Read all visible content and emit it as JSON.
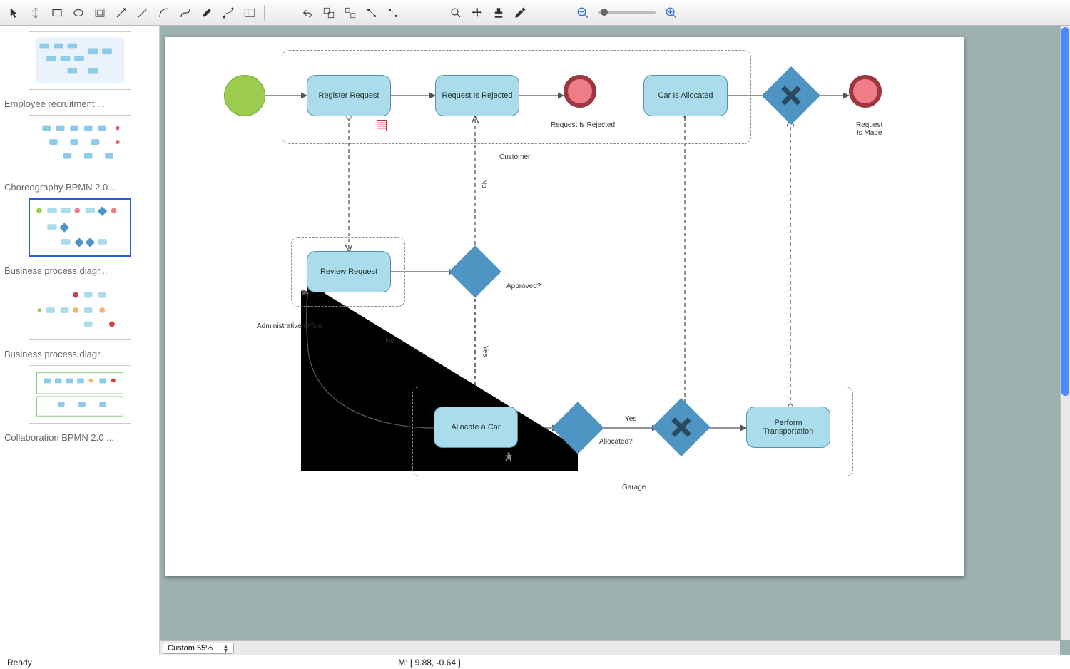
{
  "toolbar": {
    "items": [
      {
        "name": "pointer-icon"
      },
      {
        "name": "text-cursor-icon"
      },
      {
        "name": "rect-icon"
      },
      {
        "name": "ellipse-icon"
      },
      {
        "name": "container-icon"
      },
      {
        "name": "arrow-icon"
      },
      {
        "name": "line-icon"
      },
      {
        "name": "curve-icon"
      },
      {
        "name": "bezier-icon"
      },
      {
        "name": "pen-icon"
      },
      {
        "name": "node-edit-icon"
      },
      {
        "name": "pane-icon"
      }
    ],
    "edit_items": [
      {
        "name": "undo-icon"
      },
      {
        "name": "group-icon"
      },
      {
        "name": "ungroup-icon"
      },
      {
        "name": "connect-icon"
      },
      {
        "name": "disconnect-icon"
      }
    ],
    "view_items": [
      {
        "name": "zoom-icon"
      },
      {
        "name": "pan-icon"
      },
      {
        "name": "stamp-icon"
      },
      {
        "name": "eyedropper-icon"
      }
    ],
    "zoom": {
      "out": "zoom-out-icon",
      "in": "zoom-in-icon"
    }
  },
  "sidebar": {
    "items": [
      {
        "label": "Employee recruitment ..."
      },
      {
        "label": "Choreography BPMN 2.0..."
      },
      {
        "label": "Business process diagr...",
        "selected": true
      },
      {
        "label": "Business process diagr..."
      },
      {
        "label": "Collaboration BPMN 2.0 ..."
      }
    ]
  },
  "zoomSelect": "Custom 55%",
  "status": {
    "ready": "Ready",
    "coords": "M: [ 9.88, -0.64 ]"
  },
  "diagram": {
    "pools": {
      "customer": "Customer",
      "admin": "Administrative Office",
      "garage": "Garage"
    },
    "tasks": {
      "register": "Register Request",
      "reqRejected": "Request Is Rejected",
      "carAllocated": "Car Is Allocated",
      "review": "Review Request",
      "allocate": "Allocate a Car",
      "perform": "Perform Transportation"
    },
    "ends": {
      "rejected": "Request Is Rejected",
      "made": "Request\nIs Made"
    },
    "labels": {
      "approved": "Approved?",
      "no": "No",
      "yes": "Yes",
      "allocatedQ": "Allocated?",
      "yes2": "Yes",
      "no2": "No"
    }
  }
}
